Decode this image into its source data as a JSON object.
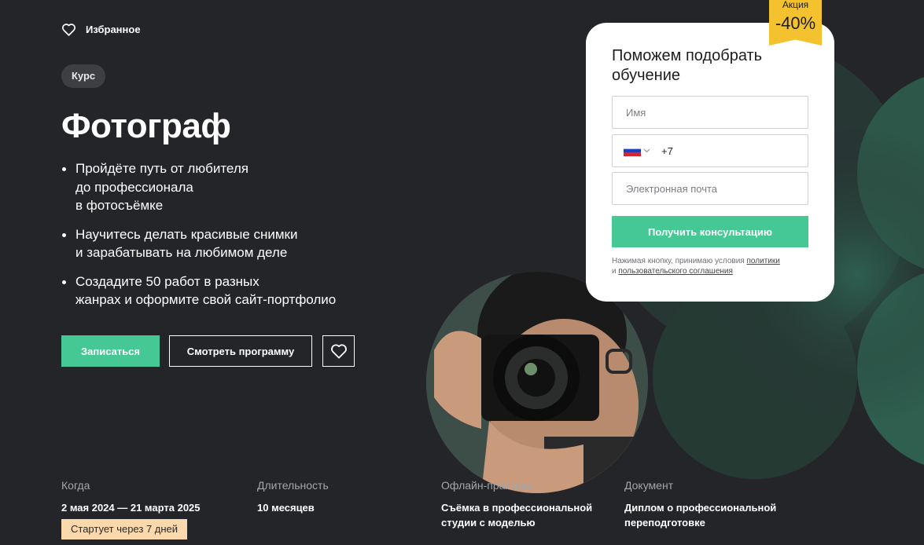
{
  "header": {
    "favorites_label": "Избранное"
  },
  "course": {
    "badge": "Курс",
    "title": "Фотограф",
    "bullets": [
      "Пройдёте путь от любителя\nдо профессионала\nв фотосъёмке",
      "Научитесь делать красивые снимки\nи зарабатывать на любимом деле",
      "Создадите 50 работ в разных\nжанрах и оформите свой сайт-портфолио"
    ],
    "enroll_label": "Записаться",
    "program_label": "Смотреть программу"
  },
  "form": {
    "title": "Поможем подобрать обучение",
    "name_placeholder": "Имя",
    "phone_prefix": "+7",
    "email_placeholder": "Электронная почта",
    "submit_label": "Получить консультацию",
    "consent_text": "Нажимая кнопку, принимаю условия ",
    "consent_link1": "политики",
    "consent_and": "и ",
    "consent_link2": "пользовательского соглашения"
  },
  "sale": {
    "label": "Акция",
    "value": "-40%"
  },
  "info": {
    "when_label": "Когда",
    "when_value": "2 мая 2024 — 21 марта 2025",
    "start_badge": "Стартует через 7 дней",
    "duration_label": "Длительность",
    "duration_value": "10 месяцев",
    "practice_label": "Офлайн-практика",
    "practice_value": "Съёмка в профессиональной\nстудии с моделью",
    "document_label": "Документ",
    "document_value": "Диплом о профессиональной\nпереподготовке"
  },
  "colors": {
    "background": "#242528",
    "accent": "#45c894",
    "sale": "#f4c22e",
    "start_badge": "#fcd8ad"
  }
}
